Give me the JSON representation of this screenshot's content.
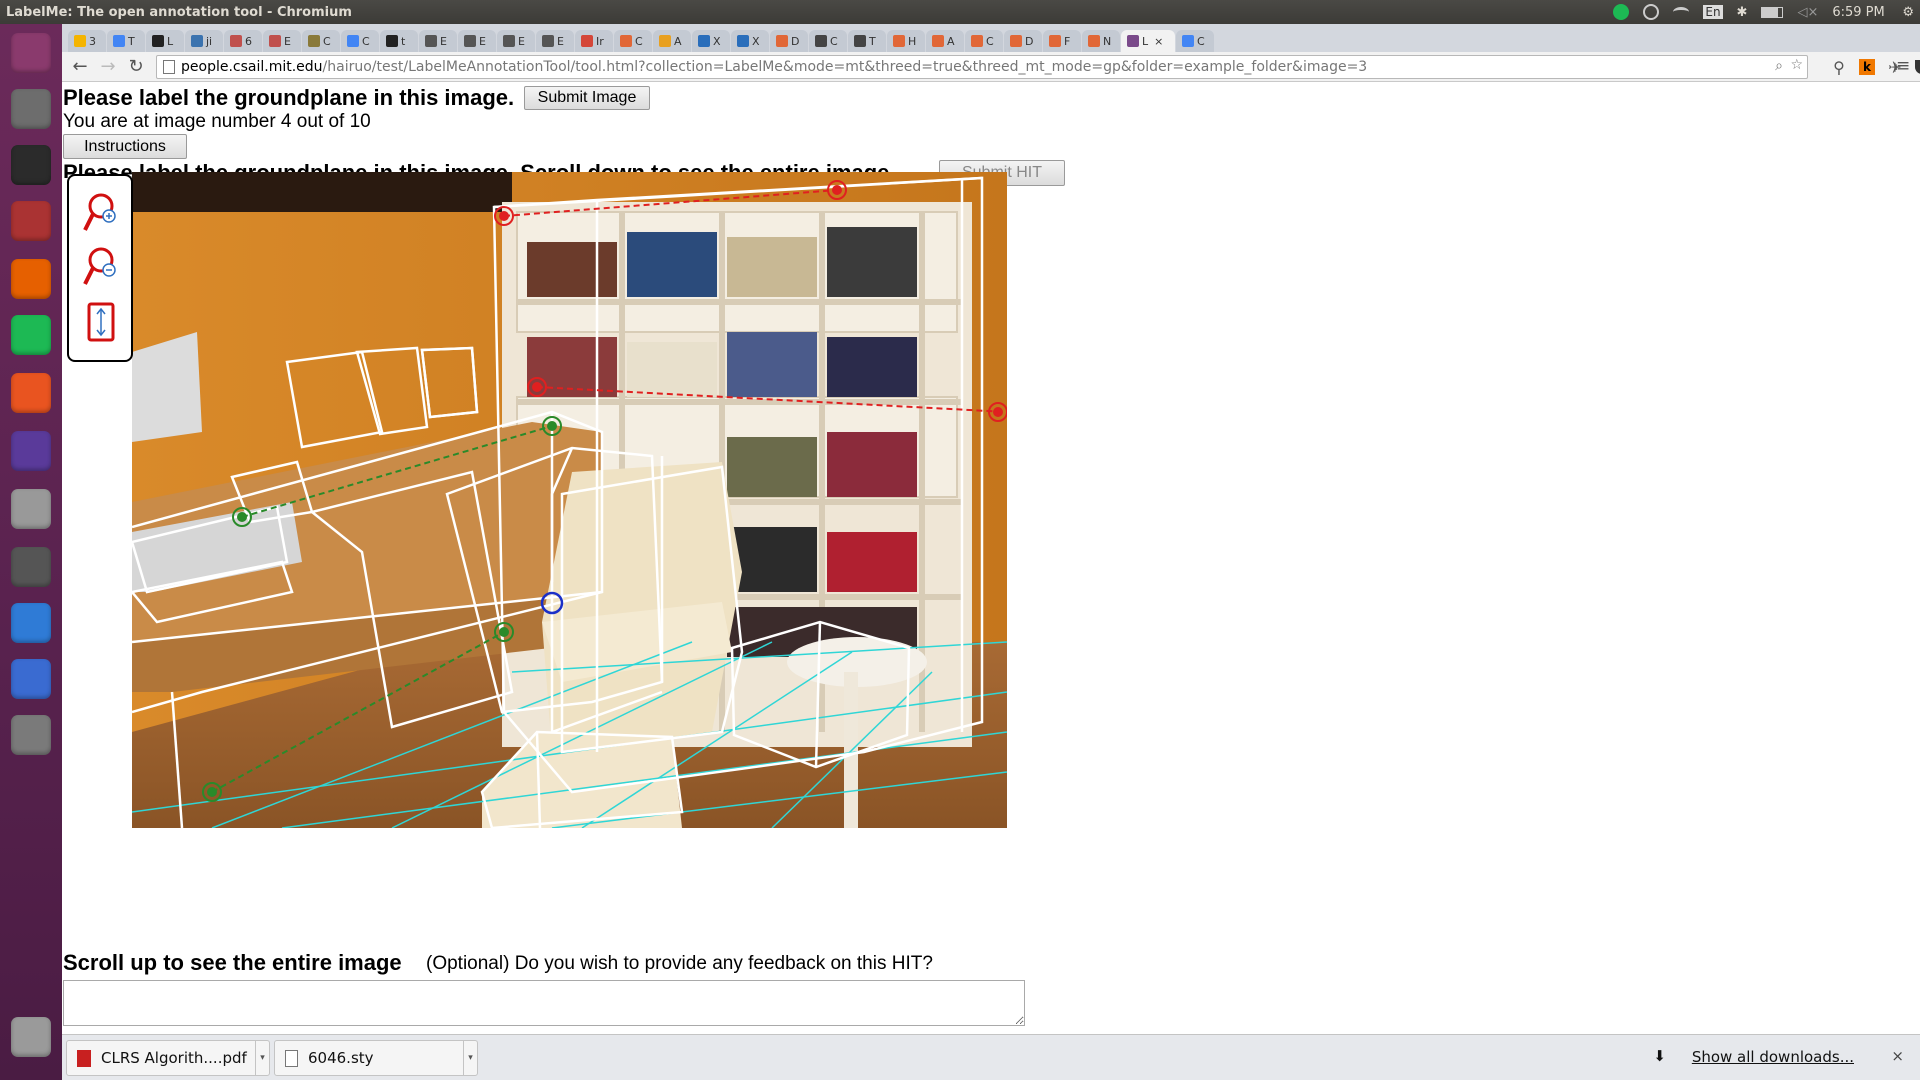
{
  "window": {
    "title": "LabelMe: The open annotation tool - Chromium"
  },
  "system": {
    "time": "6:59 PM",
    "keyboard": "En"
  },
  "launcher": {
    "items": [
      {
        "name": "dash-icon",
        "color": "#8a3a6d"
      },
      {
        "name": "files-icon",
        "color": "#6d6d6d"
      },
      {
        "name": "terminal-icon",
        "color": "#2b2b2b"
      },
      {
        "name": "settings-icon",
        "color": "#a33"
      },
      {
        "name": "firefox-icon",
        "color": "#e66000"
      },
      {
        "name": "spotify-icon",
        "color": "#1db954"
      },
      {
        "name": "software-center-icon",
        "color": "#e95420"
      },
      {
        "name": "app-circle-icon",
        "color": "#5a3a9a"
      },
      {
        "name": "disk-icon",
        "color": "#999"
      },
      {
        "name": "inkscape-icon",
        "color": "#555"
      },
      {
        "name": "chromium-icon",
        "color": "#2f7bd6"
      },
      {
        "name": "spiral-app-icon",
        "color": "#3a6bd1"
      },
      {
        "name": "updater-icon",
        "color": "#7a7a7a"
      },
      {
        "name": "trash-icon",
        "color": "#9a9a9a"
      }
    ]
  },
  "tabs": [
    {
      "label": "3",
      "icon": "drive-icon",
      "color": "#f4b400"
    },
    {
      "label": "T",
      "icon": "doc-icon",
      "color": "#4285f4"
    },
    {
      "label": "L",
      "icon": "github-icon",
      "color": "#222222"
    },
    {
      "label": "ji",
      "icon": "jira-icon",
      "color": "#3b73af"
    },
    {
      "label": "6",
      "icon": "flag-icon",
      "color": "#c0504d"
    },
    {
      "label": "E",
      "icon": "flag-icon",
      "color": "#c0504d"
    },
    {
      "label": "C",
      "icon": "bug-icon",
      "color": "#8a7a3a"
    },
    {
      "label": "C",
      "icon": "doc-icon",
      "color": "#4285f4"
    },
    {
      "label": "t",
      "icon": "github-icon",
      "color": "#222222"
    },
    {
      "label": "E",
      "icon": "wiki-icon",
      "color": "#555555"
    },
    {
      "label": "E",
      "icon": "wiki-icon",
      "color": "#555555"
    },
    {
      "label": "E",
      "icon": "wiki-icon",
      "color": "#555555"
    },
    {
      "label": "E",
      "icon": "wiki-icon",
      "color": "#555555"
    },
    {
      "label": "Ir",
      "icon": "gmail-icon",
      "color": "#d44638"
    },
    {
      "label": "C",
      "icon": "matlab-icon",
      "color": "#e16737"
    },
    {
      "label": "A",
      "icon": "circle-icon",
      "color": "#e8a020"
    },
    {
      "label": "X",
      "icon": "w3-icon",
      "color": "#2a6ebb"
    },
    {
      "label": "X",
      "icon": "w3-icon",
      "color": "#2a6ebb"
    },
    {
      "label": "D",
      "icon": "matlab-icon",
      "color": "#e16737"
    },
    {
      "label": "C",
      "icon": "wikipedia-icon",
      "color": "#444444"
    },
    {
      "label": "T",
      "icon": "wikipedia-icon",
      "color": "#444444"
    },
    {
      "label": "H",
      "icon": "matlab-icon",
      "color": "#e16737"
    },
    {
      "label": "A",
      "icon": "matlab-icon",
      "color": "#e16737"
    },
    {
      "label": "C",
      "icon": "matlab-icon",
      "color": "#e16737"
    },
    {
      "label": "D",
      "icon": "matlab-icon",
      "color": "#e16737"
    },
    {
      "label": "F",
      "icon": "matlab-icon",
      "color": "#e16737"
    },
    {
      "label": "N",
      "icon": "matlab-icon",
      "color": "#e16737"
    },
    {
      "label": "L",
      "icon": "labelme-icon",
      "color": "#7a4a8a",
      "active": true,
      "close": "×"
    },
    {
      "label": "C",
      "icon": "doc-icon",
      "color": "#4285f4"
    }
  ],
  "browser": {
    "url_host": "people.csail.mit.edu",
    "url_path": "/hairuo/test/LabelMeAnnotationTool/tool.html?collection=LabelMe&mode=mt&threed=true&threed_mt_mode=gp&folder=example_folder&image=3"
  },
  "page": {
    "heading": "Please label the groundplane in this image.",
    "submit_image": "Submit Image",
    "image_count": "You are at image number 4 out of 10",
    "instructions": "Instructions",
    "heading2": "Please label the groundplane in this image. Scroll down to see the entire image.",
    "submit_hit": "Submit HIT",
    "tools": [
      "zoom-in-icon",
      "zoom-out-icon",
      "fit-to-window-icon"
    ],
    "scroll_up": "Scroll up to see the entire image",
    "feedback_label": "(Optional) Do you wish to provide any feedback on this HIT?",
    "feedback_value": ""
  },
  "annotation_colors": {
    "box": "#ffffff",
    "ceiling_line": "#e02020",
    "ground_line": "#2a8a2a",
    "grid": "#2fd6d6",
    "selected_point": "#1a2fc8"
  },
  "downloads": {
    "items": [
      {
        "label": "CLRS Algorith....pdf",
        "icon": "pdf-icon"
      },
      {
        "label": "6046.sty",
        "icon": "file-icon"
      }
    ],
    "show_all": "Show all downloads...",
    "close": "×"
  }
}
